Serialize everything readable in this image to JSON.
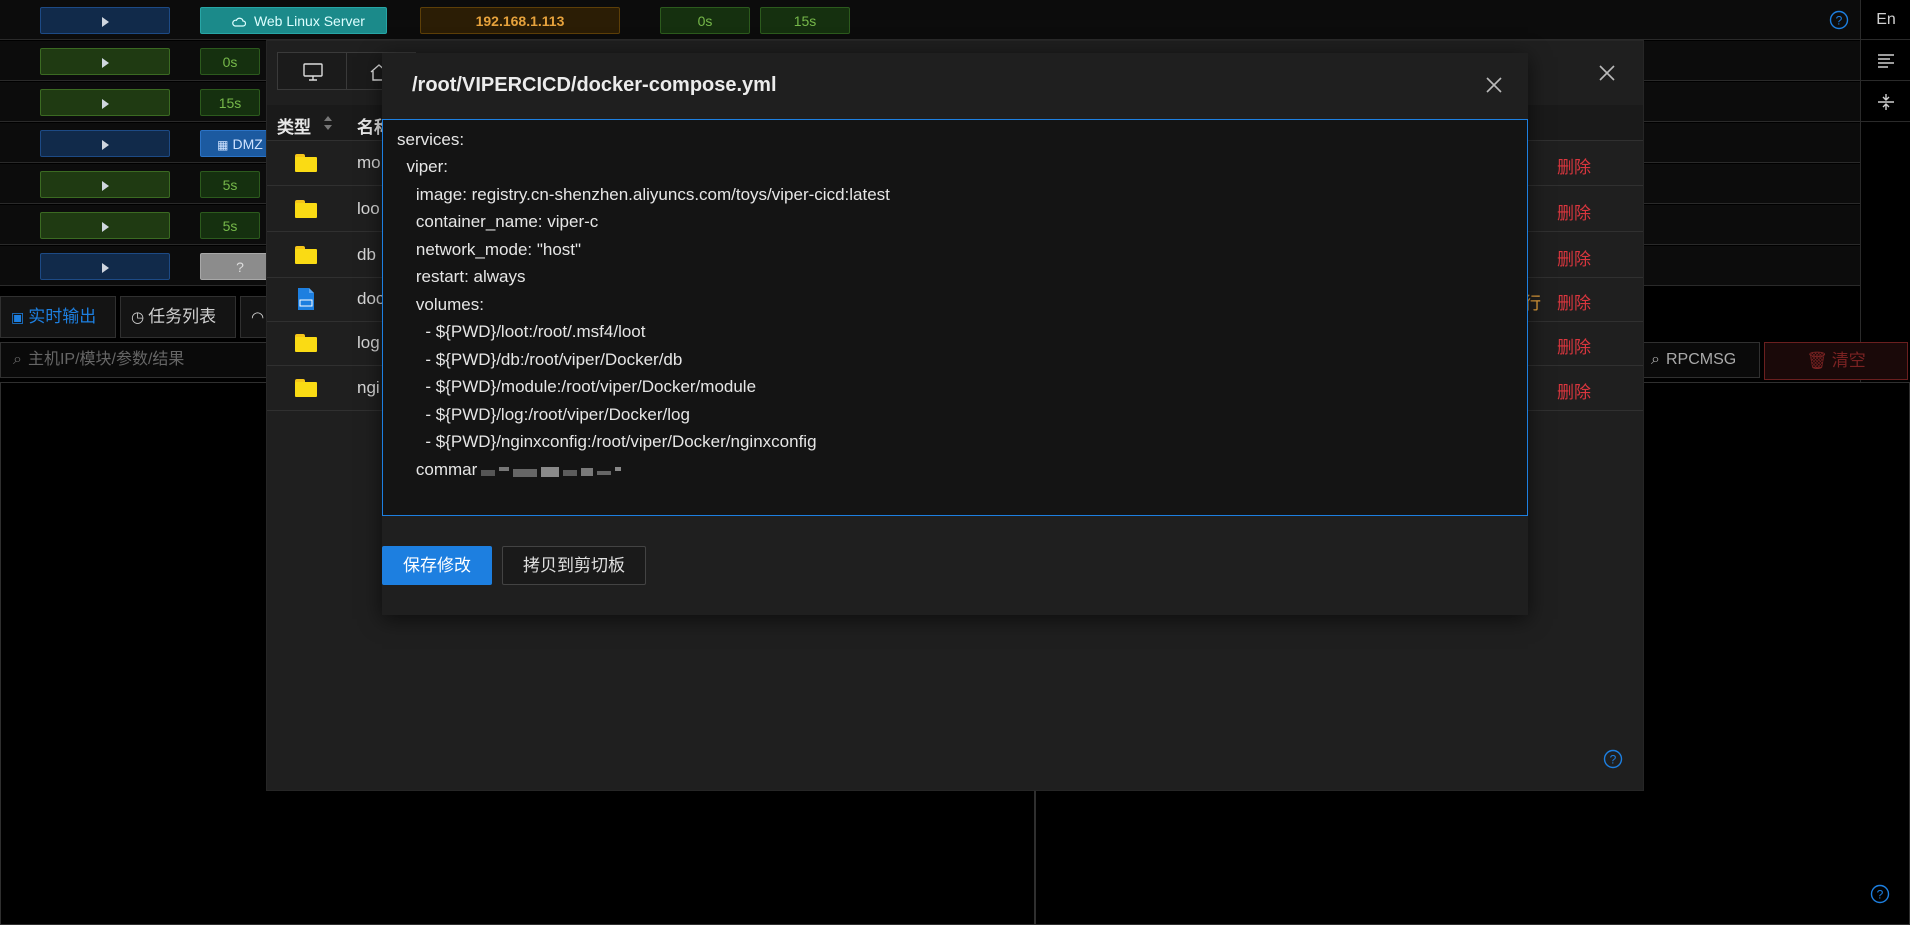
{
  "colors": {
    "accent": "#1d7fe0",
    "danger": "#d9363e",
    "warning": "#e6a23c",
    "success": "#76b84a"
  },
  "host_table": {
    "rows": [
      {
        "tag": "Web Linux Server",
        "ip": "192.168.1.113",
        "t1": "0s",
        "t2": "15s"
      },
      {
        "tag": "0s"
      },
      {
        "tag": "15s"
      },
      {
        "tag": "DMZ"
      },
      {
        "tag": "5s"
      },
      {
        "tag": "5s"
      },
      {
        "tag": "?"
      }
    ]
  },
  "side_rail": {
    "lang_label": "En"
  },
  "bottom": {
    "tab_realtime": "实时输出",
    "tab_tasks": "任务列表",
    "search_placeholder": "主机IP/模块/参数/结果",
    "rpc_search": "RPCMSG",
    "clear_label": "清空"
  },
  "file_manager": {
    "col_type": "类型",
    "col_name": "名称",
    "rows": [
      {
        "name": "mo",
        "action": "删除",
        "kind": "folder"
      },
      {
        "name": "loo",
        "action": "删除",
        "kind": "folder"
      },
      {
        "name": "db",
        "action": "删除",
        "kind": "folder"
      },
      {
        "name": "doc",
        "action": "删除",
        "kind": "file",
        "extra": "行"
      },
      {
        "name": "log",
        "action": "删除",
        "kind": "folder"
      },
      {
        "name": "ngi",
        "action": "删除",
        "kind": "folder"
      }
    ]
  },
  "editor": {
    "title": "/root/VIPERCICD/docker-compose.yml",
    "lines": [
      "services:",
      "  viper:",
      "    image: registry.cn-shenzhen.aliyuncs.com/toys/viper-cicd:latest",
      "    container_name: viper-c",
      "    network_mode: \"host\"",
      "    restart: always",
      "    volumes:",
      "      - ${PWD}/loot:/root/.msf4/loot",
      "      - ${PWD}/db:/root/viper/Docker/db",
      "      - ${PWD}/module:/root/viper/Docker/module",
      "      - ${PWD}/log:/root/viper/Docker/log",
      "      - ${PWD}/nginxconfig:/root/viper/Docker/nginxconfig",
      "    commar"
    ],
    "save_label": "保存修改",
    "copy_label": "拷贝到剪切板"
  }
}
